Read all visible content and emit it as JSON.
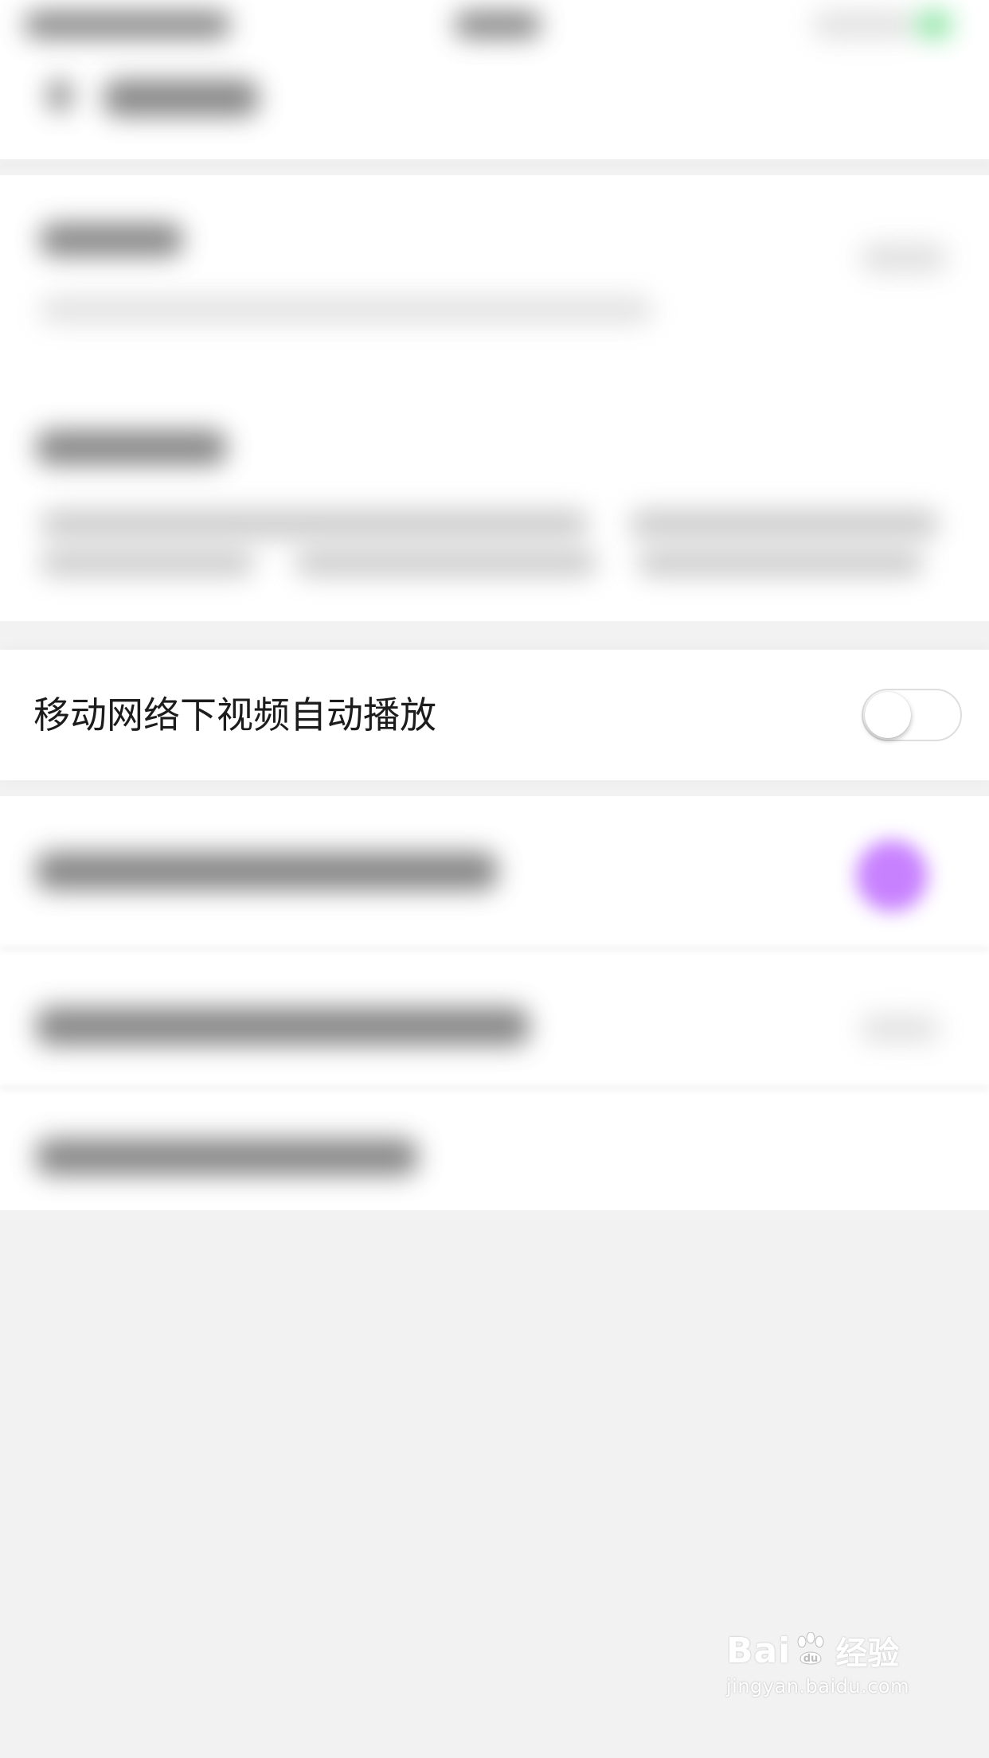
{
  "settings_item": {
    "label": "移动网络下视频自动播放",
    "enabled": false
  },
  "watermark": {
    "brand_left": "Bai",
    "brand_right": "经验",
    "url": "jingyan.baidu.com"
  },
  "colors": {
    "background": "#f2f2f2",
    "card": "#ffffff",
    "text": "#1c1c1c",
    "toggle_border": "#dedede",
    "accent_purple": "#c57bff"
  }
}
